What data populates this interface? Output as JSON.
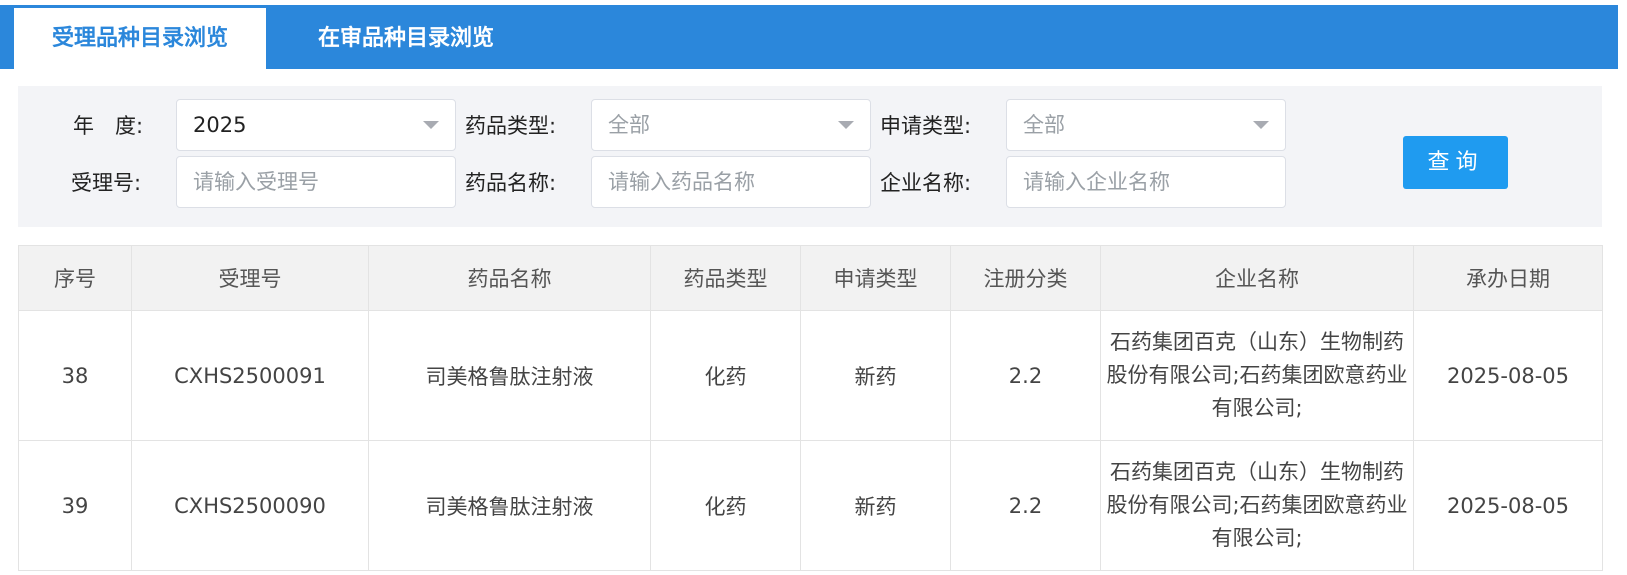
{
  "tabs": [
    {
      "label": "受理品种目录浏览",
      "active": true
    },
    {
      "label": "在审品种目录浏览",
      "active": false
    }
  ],
  "filters": {
    "year_label": "年　度:",
    "year_value": "2025",
    "drug_type_label": "药品类型:",
    "drug_type_value": "全部",
    "apply_type_label": "申请类型:",
    "apply_type_value": "全部",
    "accept_no_label": "受理号:",
    "accept_no_placeholder": "请输入受理号",
    "drug_name_label": "药品名称:",
    "drug_name_placeholder": "请输入药品名称",
    "company_label": "企业名称:",
    "company_placeholder": "请输入企业名称",
    "query_label": "查询"
  },
  "table": {
    "headers": [
      "序号",
      "受理号",
      "药品名称",
      "药品类型",
      "申请类型",
      "注册分类",
      "企业名称",
      "承办日期"
    ],
    "rows": [
      [
        "38",
        "CXHS2500091",
        "司美格鲁肽注射液",
        "化药",
        "新药",
        "2.2",
        "石药集团百克（山东）生物制药股份有限公司;石药集团欧意药业有限公司;",
        "2025-08-05"
      ],
      [
        "39",
        "CXHS2500090",
        "司美格鲁肽注射液",
        "化药",
        "新药",
        "2.2",
        "石药集团百克（山东）生物制药股份有限公司;石药集团欧意药业有限公司;",
        "2025-08-05"
      ]
    ]
  },
  "colors": {
    "accent": "#2b87db",
    "button": "#1f9bf0"
  }
}
